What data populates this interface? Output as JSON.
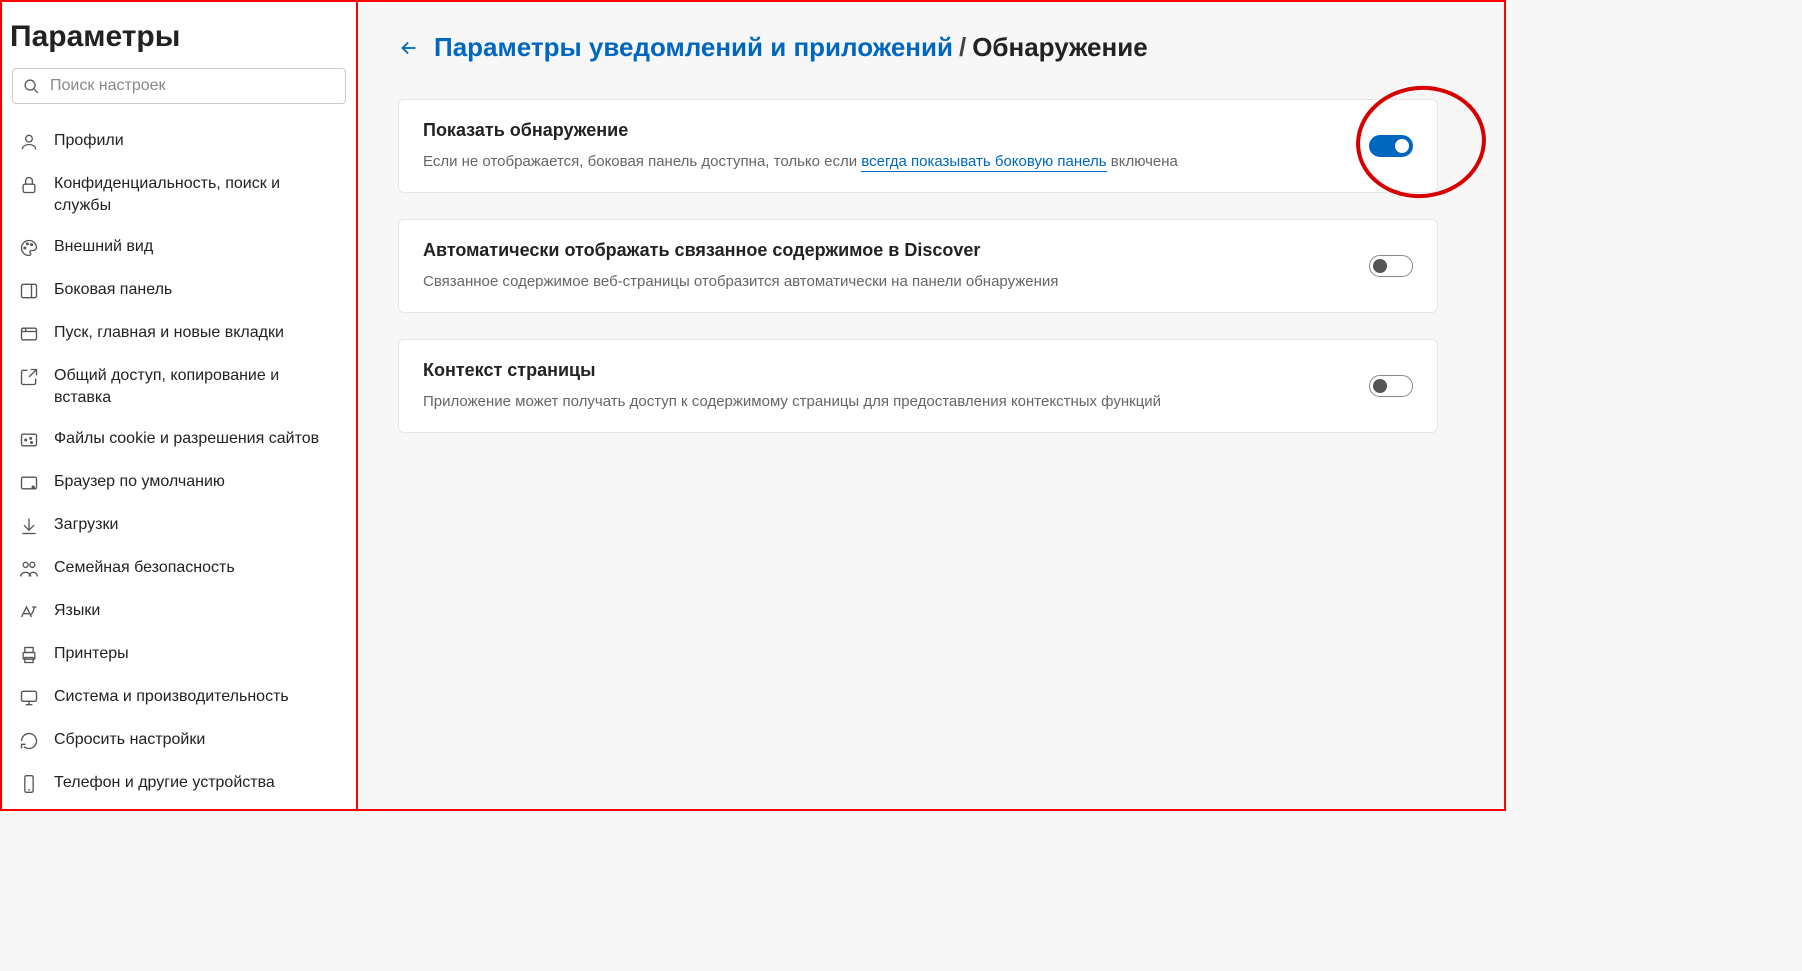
{
  "sidebar": {
    "title": "Параметры",
    "search_placeholder": "Поиск настроек",
    "items": [
      {
        "label": "Профили",
        "icon": "profile"
      },
      {
        "label": "Конфиденциальность, поиск и службы",
        "icon": "lock"
      },
      {
        "label": "Внешний вид",
        "icon": "palette"
      },
      {
        "label": "Боковая панель",
        "icon": "sidebar"
      },
      {
        "label": "Пуск, главная и новые вкладки",
        "icon": "tab"
      },
      {
        "label": "Общий доступ, копирование и вставка",
        "icon": "share"
      },
      {
        "label": "Файлы cookie и разрешения сайтов",
        "icon": "cookie"
      },
      {
        "label": "Браузер по умолчанию",
        "icon": "browser"
      },
      {
        "label": "Загрузки",
        "icon": "download"
      },
      {
        "label": "Семейная безопасность",
        "icon": "family"
      },
      {
        "label": "Языки",
        "icon": "language"
      },
      {
        "label": "Принтеры",
        "icon": "printer"
      },
      {
        "label": "Система и производительность",
        "icon": "system"
      },
      {
        "label": "Сбросить настройки",
        "icon": "reset"
      },
      {
        "label": "Телефон и другие устройства",
        "icon": "phone"
      }
    ]
  },
  "breadcrumb": {
    "parent": "Параметры уведомлений и приложений",
    "separator": "/",
    "current": "Обнаружение"
  },
  "cards": [
    {
      "title": "Показать обнаружение",
      "desc_prefix": "Если не отображается, боковая панель доступна, только если ",
      "desc_link": "всегда показывать боковую панель",
      "desc_suffix": " включена",
      "toggle": "on"
    },
    {
      "title": "Автоматически отображать связанное содержимое в Discover",
      "desc": "Связанное содержимое веб-страницы отобразится автоматически на панели обнаружения",
      "toggle": "off"
    },
    {
      "title": "Контекст страницы",
      "desc": "Приложение может получать доступ к содержимому страницы для предоставления контекстных функций",
      "toggle": "off"
    }
  ]
}
